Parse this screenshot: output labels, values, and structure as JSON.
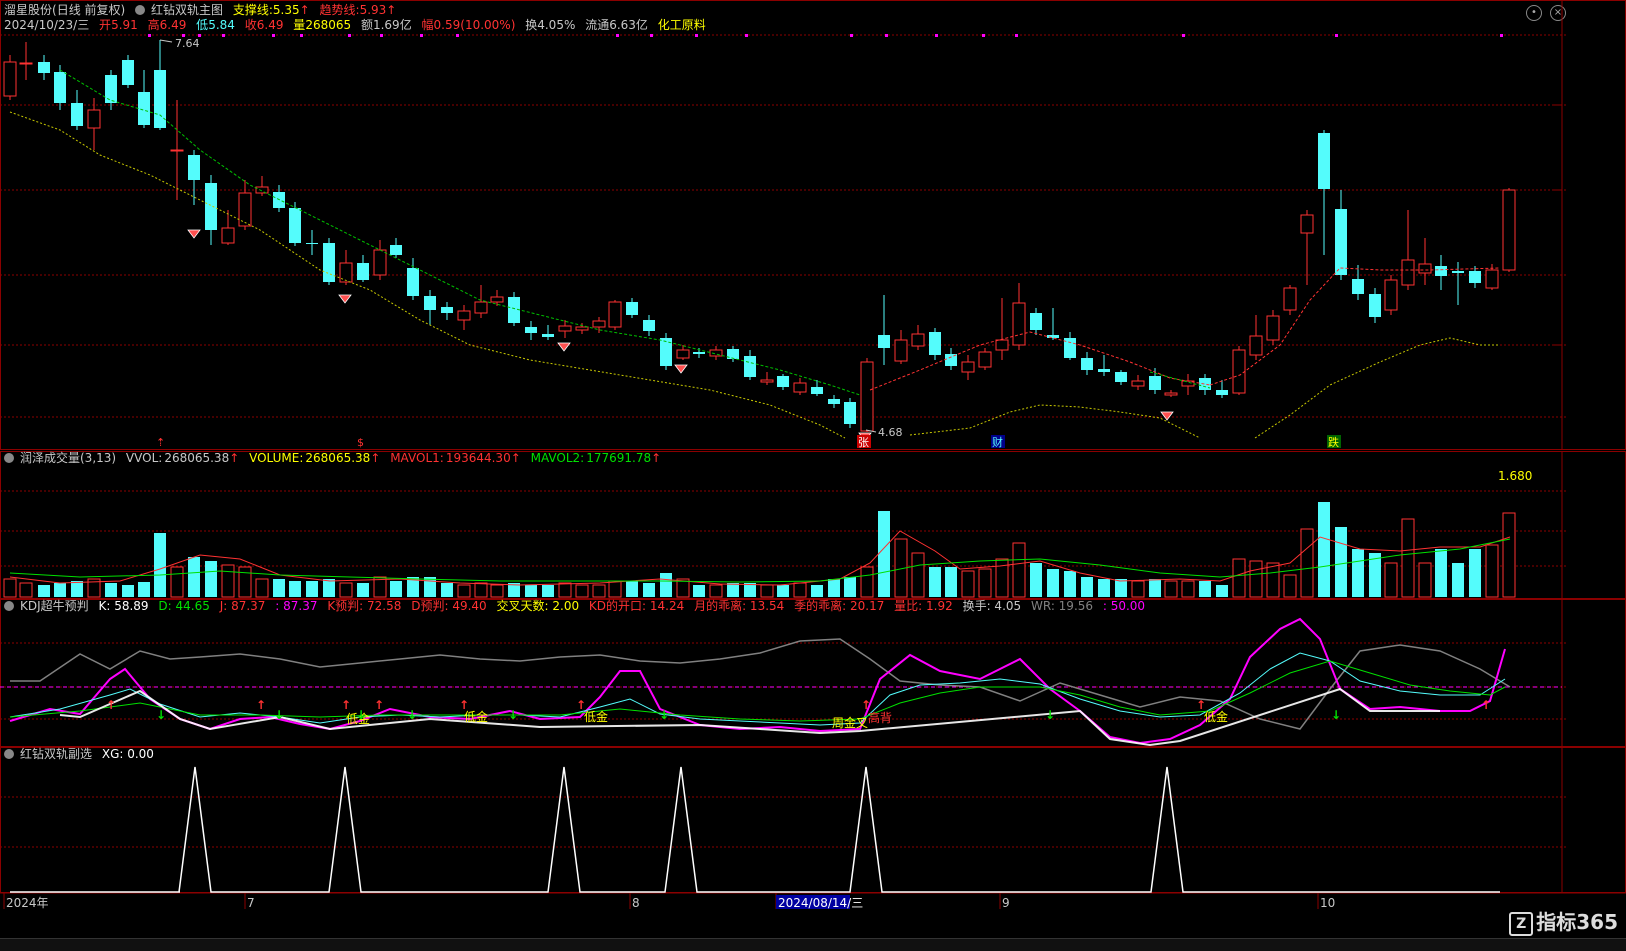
{
  "main": {
    "stock_name": "溜星股份",
    "period": "(日线 前复权)",
    "indicator": "红钻双轨主图",
    "support_label": "支撑线:",
    "support_value": "5.35",
    "trend_label": "趋势线:",
    "trend_value": "5.93",
    "date": "2024/10/23/三",
    "open_label": "开",
    "open": "5.91",
    "high_label": "高",
    "high": "6.49",
    "low_label": "低",
    "low": "5.84",
    "close_label": "收",
    "close": "6.49",
    "vol_label": "量",
    "vol": "268065",
    "amount_label": "额",
    "amount": "1.69亿",
    "change_label": "幅",
    "change": "0.59(10.00%)",
    "turnover_label": "换",
    "turnover": "4.05%",
    "float_label": "流通",
    "float": "6.63亿",
    "sector": "化工原料",
    "max_price_label": "7.64",
    "min_price_label": "4.68",
    "events": [
      "张",
      "财",
      "跌"
    ],
    "colors": {
      "up": "#ff3232",
      "down": "#54fcfc",
      "trend": "#00c000",
      "support": "#c8c800",
      "magenta": "#ff00ff"
    }
  },
  "volume": {
    "title": "润泽成交量(3,13)",
    "vol_label": "VVOL:",
    "vol": "268065.38",
    "volume_label": "VOLUME:",
    "volume": "268065.38",
    "mavol1_label": "MAVOL1:",
    "mavol1": "193644.30",
    "mavol2_label": "MAVOL2:",
    "mavol2": "177691.78",
    "scale": "1.680"
  },
  "kdj": {
    "title": "KDJ超牛预判",
    "k": "K: 58.89",
    "d": "D: 44.65",
    "j": "J: 87.37",
    "j2": ": 87.37",
    "kp": "K预判: 72.58",
    "dp": "D预判: 49.40",
    "cross": "交叉天数: 2.00",
    "open": "KD的开口: 14.24",
    "mdev": "月的乖离: 13.54",
    "qdev": "季的乖离: 20.17",
    "ratio": "量比: 1.92",
    "hand": "换手: 4.05",
    "wr": "WR: 19.56",
    "fifty": ": 50.00",
    "labels": [
      "低金",
      "低金",
      "低金",
      "低金",
      "周金叉",
      "高背",
      "低金"
    ]
  },
  "sub": {
    "title": "红钻双轨副选",
    "xg": "XG: 0.00"
  },
  "xaxis": {
    "labels": [
      "2024年",
      "7",
      "8",
      "2024/08/14/三",
      "9",
      "10"
    ]
  },
  "logo": "指标365",
  "logo_mark": "Z"
}
